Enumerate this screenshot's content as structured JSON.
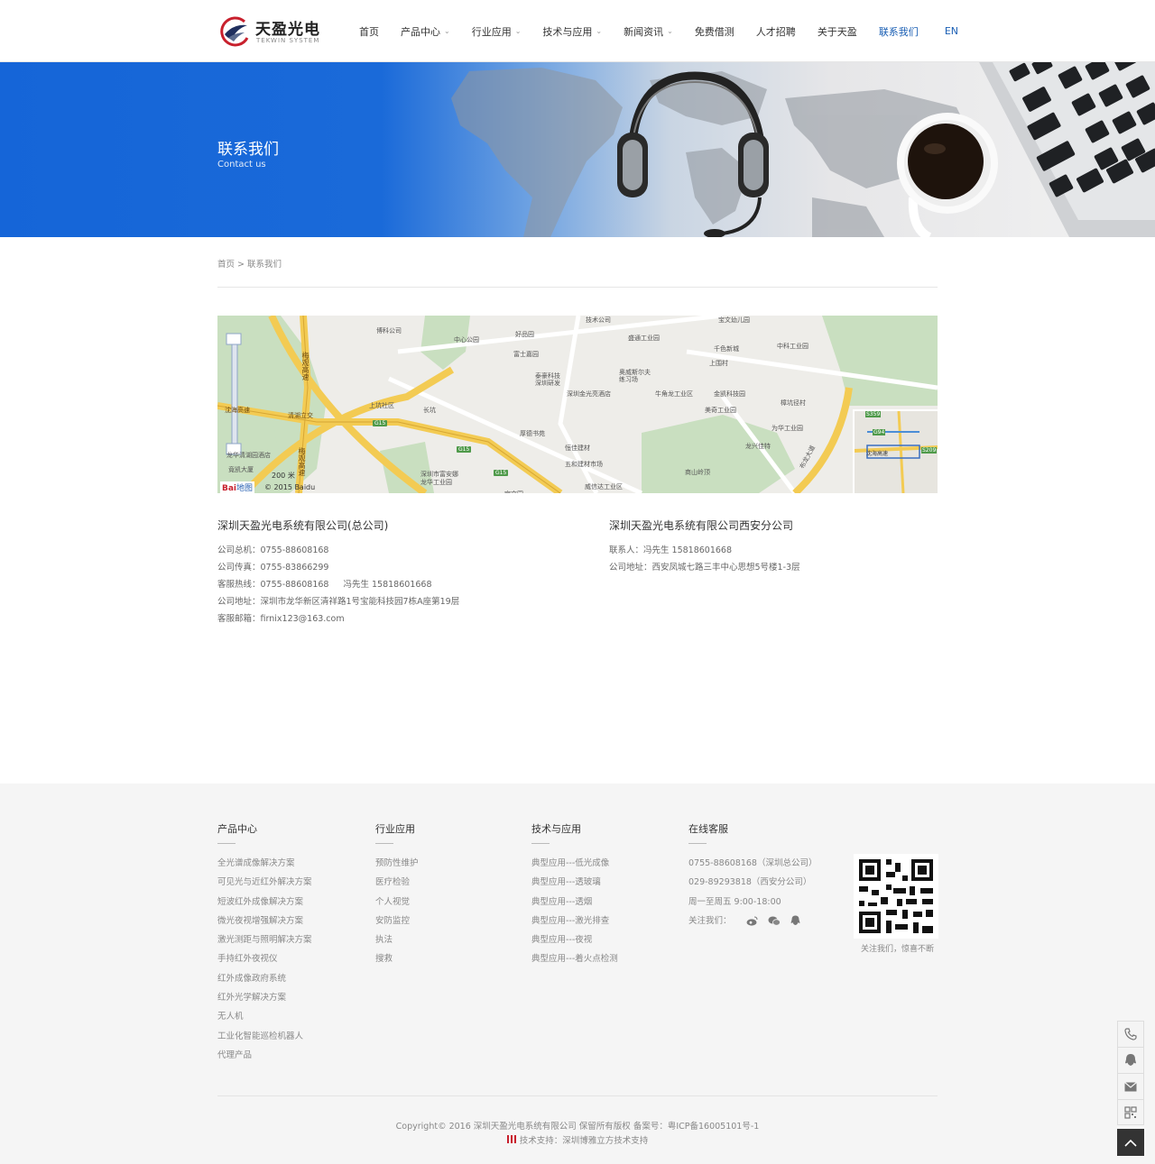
{
  "header": {
    "logo": {
      "name": "天盈光电",
      "sub": "TEKWIN SYSTEM"
    },
    "nav": [
      {
        "label": "首页",
        "dropdown": false,
        "active": false
      },
      {
        "label": "产品中心",
        "dropdown": true,
        "active": false
      },
      {
        "label": "行业应用",
        "dropdown": true,
        "active": false
      },
      {
        "label": "技术与应用",
        "dropdown": true,
        "active": false
      },
      {
        "label": "新闻资讯",
        "dropdown": true,
        "active": false
      },
      {
        "label": "免费借测",
        "dropdown": false,
        "active": false
      },
      {
        "label": "人才招聘",
        "dropdown": false,
        "active": false
      },
      {
        "label": "关于天盈",
        "dropdown": false,
        "active": false
      },
      {
        "label": "联系我们",
        "dropdown": false,
        "active": true
      }
    ],
    "lang": "EN"
  },
  "banner": {
    "title": "联系我们",
    "subtitle": "Contact us"
  },
  "breadcrumb": {
    "home": "首页",
    "sep": ">",
    "current": "联系我们"
  },
  "map": {
    "labels": [
      "博科公司",
      "中心公园",
      "好品园",
      "富士嘉园",
      "技术公司",
      "宝文幼儿园",
      "盛通工业园",
      "千色新城",
      "中科工业园",
      "上围村",
      "泰豪科技",
      "深圳研发",
      "奥威斯尔夫",
      "练习场",
      "深圳金光亮酒店",
      "牛角龙工业区",
      "金凯科技园",
      "樟坑径村",
      "美奇工业园",
      "为华工业园",
      "上坑社区",
      "长坑",
      "厚德书苑",
      "恒佳建材",
      "龙兴佳特",
      "五和建材市场",
      "商山岭顶",
      "深圳市富安娜",
      "龙华工业园",
      "威信达工业区",
      "宝文园",
      "梅观高速",
      "清湖立交",
      "沈海高速",
      "龙华清湖园酒店",
      "竟凯大厦",
      "梅观高速",
      "布龙大道"
    ],
    "roads": [
      "G15",
      "G15",
      "G15"
    ],
    "scale": "200 米",
    "copyright": "© 2015 Baidu",
    "brand": "Bai",
    "brand_cn": "地图",
    "mini_labels": [
      "S359",
      "G94",
      "沈海高速",
      "S209"
    ]
  },
  "companies": [
    {
      "name": "深圳天盈光电系统有限公司(总公司)",
      "lines": [
        {
          "label": "公司总机：",
          "value": "0755-88608168"
        },
        {
          "label": "公司传真：",
          "value": "0755-83866299"
        },
        {
          "label": "客服热线：",
          "value": "0755-88608168",
          "extra": "冯先生 15818601668"
        },
        {
          "label": "公司地址：",
          "value": "深圳市龙华新区清祥路1号宝能科技园7栋A座第19层"
        },
        {
          "label": "客服邮箱：",
          "value": "firnix123@163.com"
        }
      ]
    },
    {
      "name": "深圳天盈光电系统有限公司西安分公司",
      "lines": [
        {
          "label": "联系人：",
          "value": "冯先生 15818601668"
        },
        {
          "label": "公司地址：",
          "value": "西安凤城七路三丰中心思想5号楼1-3层"
        }
      ]
    }
  ],
  "footer": {
    "columns": [
      {
        "title": "产品中心",
        "links": [
          "全光谱成像解决方案",
          "可见光与近红外解决方案",
          "短波红外成像解决方案",
          "微光夜视增强解决方案",
          "激光测距与照明解决方案",
          "手持红外夜视仪",
          "红外成像政府系统",
          "红外光学解决方案",
          "无人机",
          "工业化智能巡检机器人",
          "代理产品"
        ]
      },
      {
        "title": "行业应用",
        "links": [
          "预防性维护",
          "医疗检验",
          "个人视觉",
          "安防监控",
          "执法",
          "搜救"
        ]
      },
      {
        "title": "技术与应用",
        "links": [
          "典型应用---低光成像",
          "典型应用---透玻璃",
          "典型应用---透烟",
          "典型应用---激光排查",
          "典型应用---夜视",
          "典型应用---着火点检测"
        ]
      },
      {
        "title": "在线客服",
        "links": [
          "0755-88608168（深圳总公司）",
          "029-89293818（西安分公司）",
          "周一至周五 9:00-18:00"
        ],
        "follow": "关注我们："
      }
    ],
    "qr_caption": "关注我们，惊喜不断",
    "copyright": "Copyright© 2016 深圳天盈光电系统有限公司 保留所有版权 备案号：粤ICP备16005101号-1",
    "support": "技术支持：深圳博雅立方技术支持"
  },
  "colors": {
    "accent": "#1a5fb4",
    "banner_blue": "#1565d8",
    "logo_red": "#c8202d",
    "logo_navy": "#1f2f5e"
  }
}
